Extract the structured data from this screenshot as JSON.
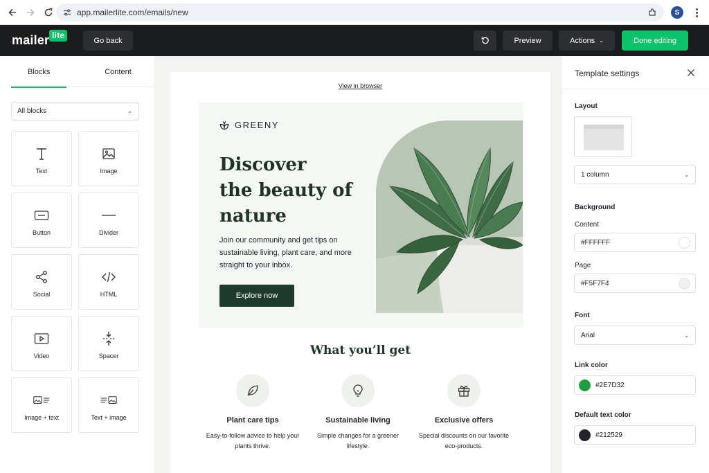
{
  "browser": {
    "url": "app.mailerlite.com/emails/new",
    "profile_initial": "S"
  },
  "header": {
    "logo_text": "mailer",
    "logo_badge": "lite",
    "go_back": "Go back",
    "preview": "Preview",
    "actions": "Actions",
    "done": "Done editing"
  },
  "left": {
    "tabs": [
      "Blocks",
      "Content"
    ],
    "filter": "All blocks",
    "blocks": [
      {
        "label": "Text",
        "icon": "text-icon"
      },
      {
        "label": "Image",
        "icon": "image-icon"
      },
      {
        "label": "Button",
        "icon": "button-icon"
      },
      {
        "label": "Divider",
        "icon": "divider-icon"
      },
      {
        "label": "Social",
        "icon": "share-icon"
      },
      {
        "label": "HTML",
        "icon": "code-icon"
      },
      {
        "label": "Video",
        "icon": "video-icon"
      },
      {
        "label": "Spacer",
        "icon": "spacer-icon"
      },
      {
        "label": "Image + text",
        "icon": "image-text-icon"
      },
      {
        "label": "Text + image",
        "icon": "text-image-icon"
      }
    ]
  },
  "email": {
    "view_in_browser": "View in browser",
    "brand": "GREENY",
    "title_lines": [
      "Discover",
      "the beauty of",
      "nature"
    ],
    "body": "Join our community and get tips on sustainable living, plant care, and more straight to your inbox.",
    "cta": "Explore now",
    "section_title": "What you’ll get",
    "features": [
      {
        "title": "Plant care tips",
        "desc": "Easy-to-follow advice to help your plants thrive.",
        "icon": "leaf-icon"
      },
      {
        "title": "Sustainable living",
        "desc": "Simple changes for a greener lifestyle.",
        "icon": "lightbulb-icon"
      },
      {
        "title": "Exclusive offers",
        "desc": "Special discounts on our favorite eco-products.",
        "icon": "gift-icon"
      }
    ]
  },
  "settings": {
    "title": "Template settings",
    "layout_label": "Layout",
    "layout_value": "1 column",
    "background_label": "Background",
    "content_label": "Content",
    "content_value": "#FFFFFF",
    "page_label": "Page",
    "page_value": "#F5F7F4",
    "font_label": "Font",
    "font_value": "Arial",
    "link_color_label": "Link color",
    "link_color_value": "#2E7D32",
    "text_color_label": "Default text color",
    "text_color_value": "#212529"
  },
  "colors": {
    "accent": "#09C269",
    "header_bg": "#1B1C1E",
    "hero_bg": "#F5F7F4",
    "cta_bg": "#1D3A2D"
  }
}
